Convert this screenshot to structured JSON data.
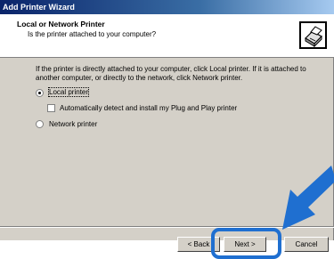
{
  "window": {
    "title": "Add Printer Wizard"
  },
  "header": {
    "title": "Local or Network Printer",
    "subtitle": "Is the printer attached to your computer?",
    "icon": "printer-icon"
  },
  "body": {
    "intro_line1": "If the printer is directly attached to your computer, click Local printer.  If it is attached to",
    "intro_line2": "another computer, or directly to the network, click Network printer.",
    "options": {
      "local": {
        "label": "Local printer",
        "selected": true
      },
      "auto_detect": {
        "label": "Automatically detect and install my Plug and Play printer",
        "checked": false
      },
      "network": {
        "label": "Network printer",
        "selected": false
      }
    }
  },
  "buttons": {
    "back": "< Back",
    "next": "Next >",
    "cancel": "Cancel"
  },
  "annotation": {
    "color": "#1f6fd0",
    "arrow_icon": "pointer-arrow-icon"
  }
}
